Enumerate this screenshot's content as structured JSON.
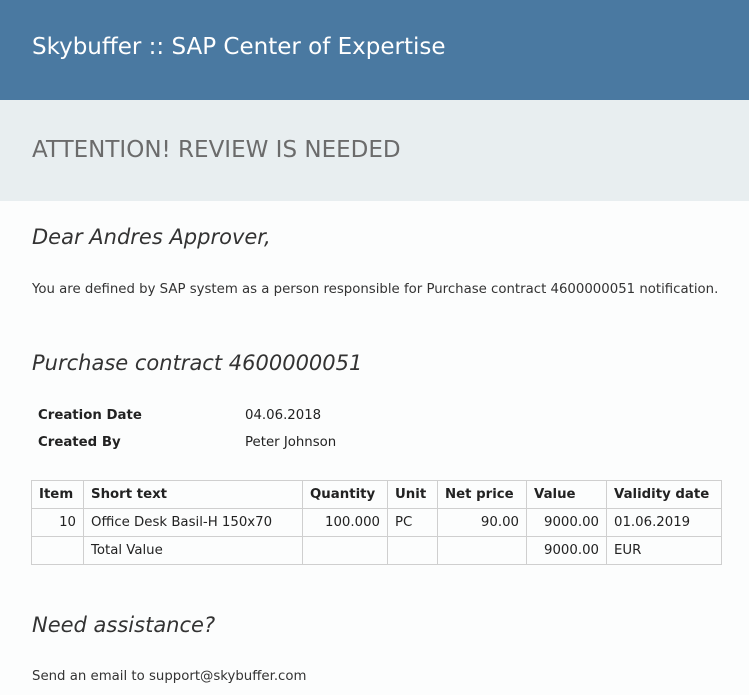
{
  "header": {
    "title": "Skybuffer :: SAP Center of Expertise"
  },
  "attention": {
    "text": "ATTENTION! REVIEW IS NEEDED"
  },
  "greeting": "Dear Andres Approver,",
  "intro": "You are defined by SAP system as a person responsible for Purchase contract 4600000051 notification.",
  "contract": {
    "title": "Purchase contract 4600000051",
    "creation_date_label": "Creation Date",
    "creation_date": "04.06.2018",
    "created_by_label": "Created By",
    "created_by": "Peter Johnson"
  },
  "table": {
    "headers": [
      "Item",
      "Short text",
      "Quantity",
      "Unit",
      "Net price",
      "Value",
      "Validity date"
    ],
    "rows": [
      [
        "10",
        "Office Desk Basil-H 150x70",
        "100.000",
        "PC",
        "90.00",
        "9000.00",
        "01.06.2019"
      ],
      [
        "",
        "Total Value",
        "",
        "",
        "",
        "9000.00",
        "EUR"
      ]
    ]
  },
  "assistance": {
    "title": "Need assistance?",
    "text": "Send an email to support@skybuffer.com"
  },
  "colors": {
    "header_bg": "#4a79a1",
    "attention_bg": "#e8eef0",
    "attention_text": "#6b6b6b"
  }
}
